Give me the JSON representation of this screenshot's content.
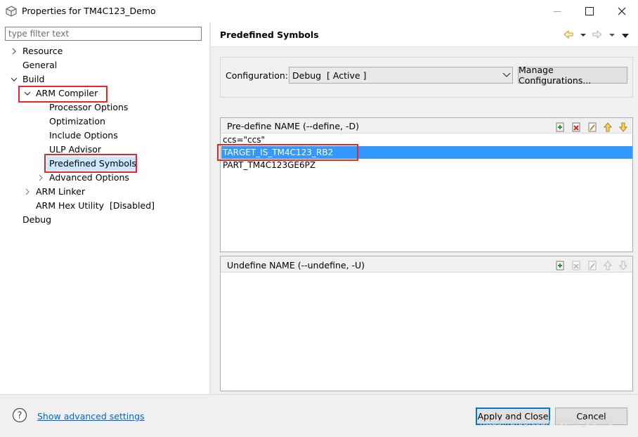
{
  "window": {
    "title": "Properties for TM4C123_Demo",
    "minimize_glyph": "—",
    "maximize_glyph": "☐",
    "close_glyph": "✕"
  },
  "filter": {
    "placeholder": "type filter text",
    "value": ""
  },
  "tree": {
    "resource": "Resource",
    "general": "General",
    "build": "Build",
    "arm_compiler": "ARM Compiler",
    "processor_options": "Processor Options",
    "optimization": "Optimization",
    "include_options": "Include Options",
    "ulp_advisor": "ULP Advisor",
    "predefined_symbols": "Predefined Symbols",
    "advanced_options": "Advanced Options",
    "arm_linker": "ARM Linker",
    "arm_hex_utility": "ARM Hex Utility  [Disabled]",
    "debug": "Debug"
  },
  "page": {
    "title": "Predefined Symbols",
    "configuration_label": "Configuration:",
    "configuration_value": "Debug  [ Active ]",
    "manage_button": "Manage Configurations..."
  },
  "predefine": {
    "header": "Pre-define NAME (--define, -D)",
    "rows": [
      "ccs=\"ccs\"",
      "TARGET_IS_TM4C123_RB2",
      "PART_TM4C123GE6PZ"
    ],
    "selected_index": 1
  },
  "undefine": {
    "header": "Undefine NAME (--undefine, -U)",
    "rows": []
  },
  "bottom": {
    "advanced_link": "Show advanced settings",
    "apply_button": "Apply and Close",
    "cancel_button": "Cancel",
    "watermark": "https://blog.csdn.net/Mr_Define"
  },
  "colors": {
    "selection": "#3399ff",
    "tree_selection": "#cce8ff",
    "annotation": "#e5262a",
    "link": "#0066cc"
  }
}
